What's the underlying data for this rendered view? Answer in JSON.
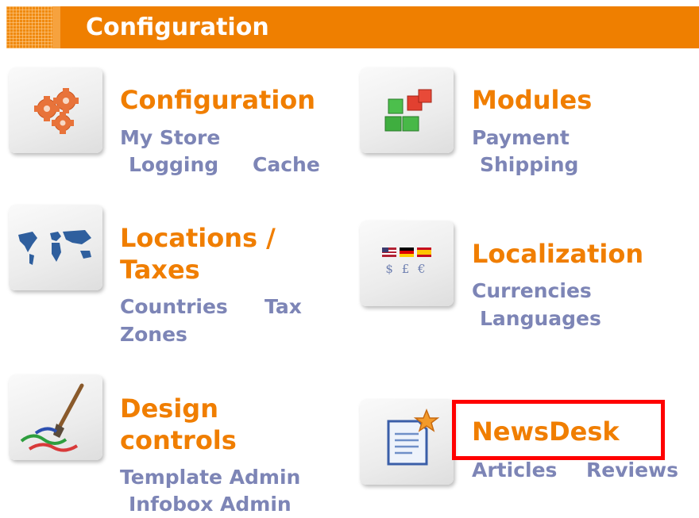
{
  "header": {
    "title": "Configuration"
  },
  "sections": {
    "configuration": {
      "title": "Configuration",
      "links": [
        "My Store",
        "Logging",
        "Cache"
      ],
      "icon": "gears-icon"
    },
    "modules": {
      "title": "Modules",
      "links": [
        "Payment",
        "Shipping"
      ],
      "icon": "cubes-icon"
    },
    "locations": {
      "title_line1": "Locations /",
      "title_line2": "Taxes",
      "links": [
        "Countries",
        "Tax",
        "Zones"
      ],
      "icon": "world-map-icon"
    },
    "localization": {
      "title": "Localization",
      "links": [
        "Currencies",
        "Languages"
      ],
      "currency_symbols": "$ £ €",
      "icon": "currency-flags-icon"
    },
    "design": {
      "title_line1": "Design",
      "title_line2": "controls",
      "links": [
        "Template Admin",
        "Infobox Admin"
      ],
      "icon": "paintbrush-icon"
    },
    "newsdesk": {
      "title": "NewsDesk",
      "links": [
        "Articles",
        "Reviews"
      ],
      "icon": "document-star-icon"
    }
  },
  "colors": {
    "header": "#ef7f00",
    "section_title": "#f07e00",
    "link": "#7d85b6",
    "highlight": "#ff0000"
  }
}
